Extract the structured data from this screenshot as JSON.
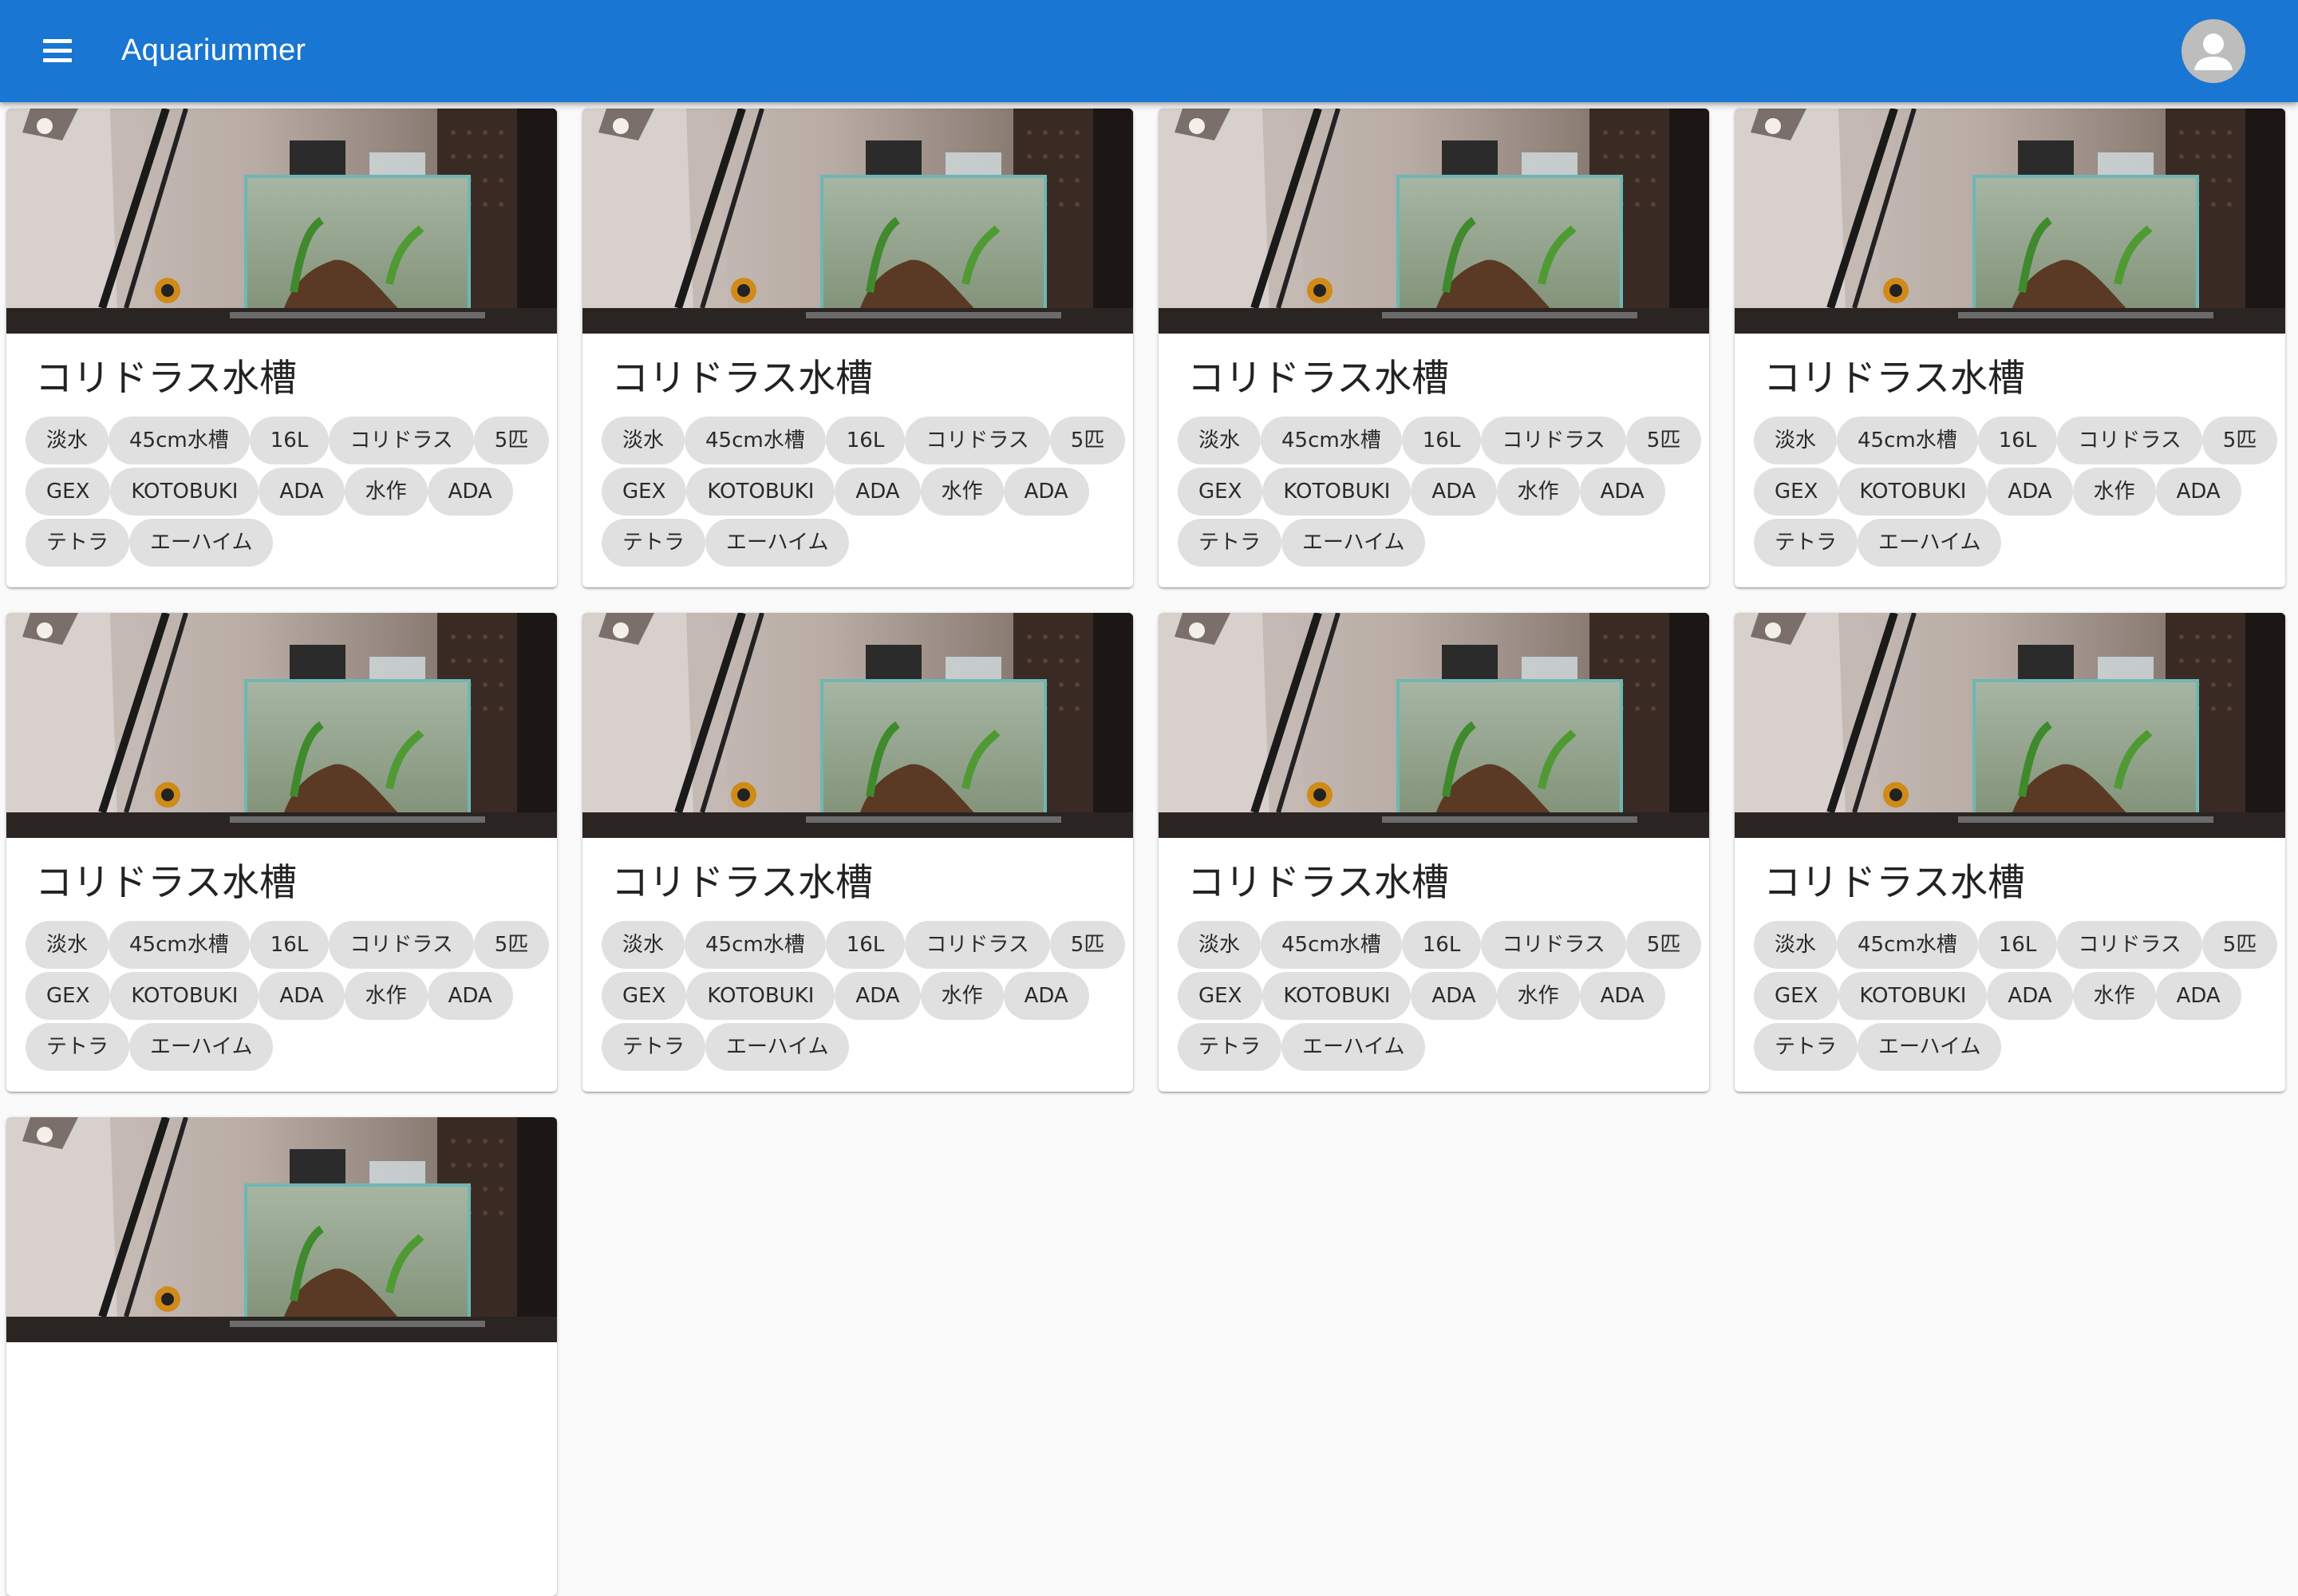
{
  "appbar": {
    "title": "Aquariummer",
    "colors": {
      "background": "#1976d2",
      "text": "#ffffff"
    },
    "menu_icon": "menu-icon",
    "account_icon": "account-circle-icon"
  },
  "cards": [
    {
      "title": "コリドラス水槽",
      "image_icon": "aquarium-photo",
      "tags": [
        "淡水",
        "45cm水槽",
        "16L",
        "コリドラス",
        "5匹",
        "GEX",
        "KOTOBUKI",
        "ADA",
        "水作",
        "ADA",
        "テトラ",
        "エーハイム"
      ]
    },
    {
      "title": "コリドラス水槽",
      "image_icon": "aquarium-photo",
      "tags": [
        "淡水",
        "45cm水槽",
        "16L",
        "コリドラス",
        "5匹",
        "GEX",
        "KOTOBUKI",
        "ADA",
        "水作",
        "ADA",
        "テトラ",
        "エーハイム"
      ]
    },
    {
      "title": "コリドラス水槽",
      "image_icon": "aquarium-photo",
      "tags": [
        "淡水",
        "45cm水槽",
        "16L",
        "コリドラス",
        "5匹",
        "GEX",
        "KOTOBUKI",
        "ADA",
        "水作",
        "ADA",
        "テトラ",
        "エーハイム"
      ]
    },
    {
      "title": "コリドラス水槽",
      "image_icon": "aquarium-photo",
      "tags": [
        "淡水",
        "45cm水槽",
        "16L",
        "コリドラス",
        "5匹",
        "GEX",
        "KOTOBUKI",
        "ADA",
        "水作",
        "ADA",
        "テトラ",
        "エーハイム"
      ]
    },
    {
      "title": "コリドラス水槽",
      "image_icon": "aquarium-photo",
      "tags": [
        "淡水",
        "45cm水槽",
        "16L",
        "コリドラス",
        "5匹",
        "GEX",
        "KOTOBUKI",
        "ADA",
        "水作",
        "ADA",
        "テトラ",
        "エーハイム"
      ]
    },
    {
      "title": "コリドラス水槽",
      "image_icon": "aquarium-photo",
      "tags": [
        "淡水",
        "45cm水槽",
        "16L",
        "コリドラス",
        "5匹",
        "GEX",
        "KOTOBUKI",
        "ADA",
        "水作",
        "ADA",
        "テトラ",
        "エーハイム"
      ]
    },
    {
      "title": "コリドラス水槽",
      "image_icon": "aquarium-photo",
      "tags": [
        "淡水",
        "45cm水槽",
        "16L",
        "コリドラス",
        "5匹",
        "GEX",
        "KOTOBUKI",
        "ADA",
        "水作",
        "ADA",
        "テトラ",
        "エーハイム"
      ]
    },
    {
      "title": "コリドラス水槽",
      "image_icon": "aquarium-photo",
      "tags": [
        "淡水",
        "45cm水槽",
        "16L",
        "コリドラス",
        "5匹",
        "GEX",
        "KOTOBUKI",
        "ADA",
        "水作",
        "ADA",
        "テトラ",
        "エーハイム"
      ]
    },
    {
      "title": "",
      "image_icon": "aquarium-photo",
      "tags": []
    }
  ]
}
